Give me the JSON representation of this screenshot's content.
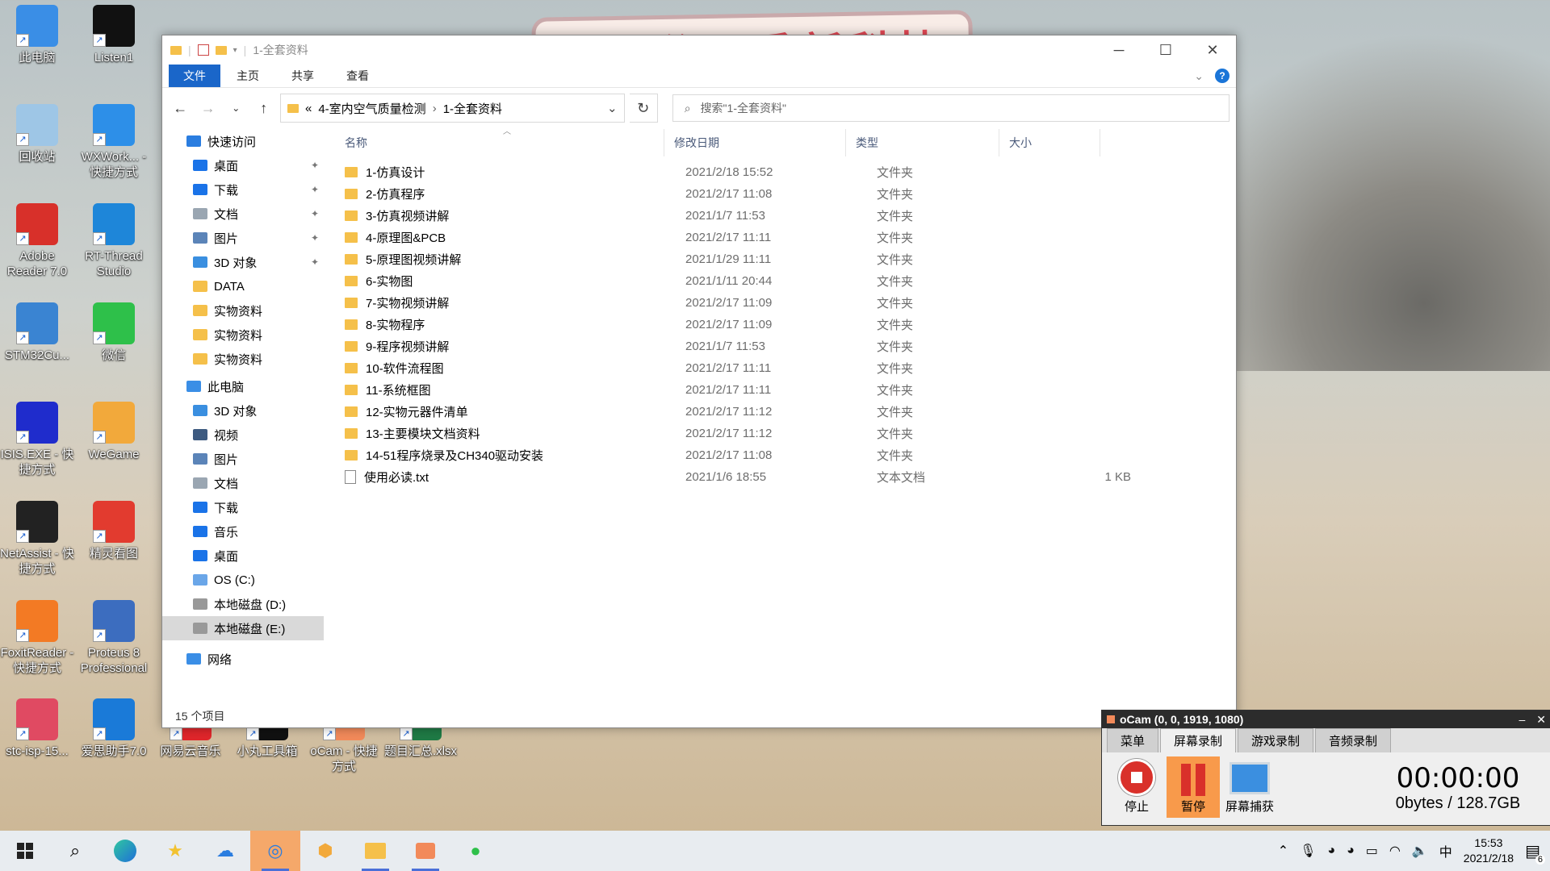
{
  "desktop_icons": [
    {
      "label": "此电脑",
      "color": "#3a8ee6"
    },
    {
      "label": "Listen1",
      "color": "#111111"
    },
    {
      "label": "回收站",
      "color": "#9ec6e6"
    },
    {
      "label": "WXWork... - 快捷方式",
      "color": "#2d8fe8"
    },
    {
      "label": "Adobe Reader 7.0",
      "color": "#d8302a"
    },
    {
      "label": "RT-Thread Studio",
      "color": "#1e86d9"
    },
    {
      "label": "STM32Cu...",
      "color": "#3a84d2"
    },
    {
      "label": "微信",
      "color": "#2ec04a"
    },
    {
      "label": "ISIS.EXE - 快捷方式",
      "color": "#1f2ccc"
    },
    {
      "label": "WeGame",
      "color": "#f2a93b"
    },
    {
      "label": "NetAssist - 快捷方式",
      "color": "#222222"
    },
    {
      "label": "精灵看图",
      "color": "#e23b2f"
    },
    {
      "label": "FoxitReader - 快捷方式",
      "color": "#f37a24"
    },
    {
      "label": "Proteus 8 Professional",
      "color": "#3c6dbf"
    },
    {
      "label": "stc-isp-15...",
      "color": "#e04a62"
    },
    {
      "label": "爱思助手7.0",
      "color": "#1a7ad8"
    },
    {
      "label": "网易云音乐",
      "color": "#e0262b"
    },
    {
      "label": "小丸工具箱",
      "color": "#111111"
    },
    {
      "label": "oCam - 快捷方式",
      "color": "#f28a5a"
    },
    {
      "label": "题目汇总.xlsx",
      "color": "#1f7a45"
    }
  ],
  "banner_text": "马爸爸：秀新科技",
  "explorer": {
    "title": "1-全套资料",
    "ribbon_tabs": [
      "文件",
      "主页",
      "共享",
      "查看"
    ],
    "address": {
      "prefix": "«",
      "crumbs": [
        "4-室内空气质量检测",
        "1-全套资料"
      ]
    },
    "search_placeholder": "搜索\"1-全套资料\"",
    "nav": {
      "quick_access": "快速访问",
      "quick_items": [
        {
          "label": "桌面",
          "icon": "desktop-icon",
          "color": "#1a73e8",
          "pinned": true
        },
        {
          "label": "下载",
          "icon": "download-icon",
          "color": "#1a73e8",
          "pinned": true
        },
        {
          "label": "文档",
          "icon": "document-icon",
          "color": "#9aa6b2",
          "pinned": true
        },
        {
          "label": "图片",
          "icon": "picture-icon",
          "color": "#5b84b8",
          "pinned": true
        },
        {
          "label": "3D 对象",
          "icon": "cube-icon",
          "color": "#3a8fe0",
          "pinned": true
        },
        {
          "label": "DATA",
          "icon": "folder-icon",
          "color": "#f5c04a",
          "pinned": false
        },
        {
          "label": "实物资料",
          "icon": "folder-icon",
          "color": "#f5c04a",
          "pinned": false
        },
        {
          "label": "实物资料",
          "icon": "folder-icon",
          "color": "#f5c04a",
          "pinned": false
        },
        {
          "label": "实物资料",
          "icon": "folder-icon",
          "color": "#f5c04a",
          "pinned": false
        }
      ],
      "this_pc": "此电脑",
      "pc_items": [
        {
          "label": "3D 对象",
          "icon": "cube-icon",
          "color": "#3a8fe0"
        },
        {
          "label": "视频",
          "icon": "video-icon",
          "color": "#3d5a80"
        },
        {
          "label": "图片",
          "icon": "picture-icon",
          "color": "#5b84b8"
        },
        {
          "label": "文档",
          "icon": "document-icon",
          "color": "#9aa6b2"
        },
        {
          "label": "下载",
          "icon": "download-icon",
          "color": "#1a73e8"
        },
        {
          "label": "音乐",
          "icon": "music-icon",
          "color": "#1a73e8"
        },
        {
          "label": "桌面",
          "icon": "desktop-icon",
          "color": "#1a73e8"
        },
        {
          "label": "OS (C:)",
          "icon": "windows-drive-icon",
          "color": "#6aa6e8"
        },
        {
          "label": "本地磁盘 (D:)",
          "icon": "drive-icon",
          "color": "#999999"
        },
        {
          "label": "本地磁盘 (E:)",
          "icon": "drive-icon",
          "color": "#999999"
        }
      ],
      "network": "网络"
    },
    "columns": [
      "名称",
      "修改日期",
      "类型",
      "大小"
    ],
    "files": [
      {
        "name": "1-仿真设计",
        "date": "2021/2/18 15:52",
        "type": "文件夹",
        "size": ""
      },
      {
        "name": "2-仿真程序",
        "date": "2021/2/17 11:08",
        "type": "文件夹",
        "size": ""
      },
      {
        "name": "3-仿真视频讲解",
        "date": "2021/1/7 11:53",
        "type": "文件夹",
        "size": ""
      },
      {
        "name": "4-原理图&PCB",
        "date": "2021/2/17 11:11",
        "type": "文件夹",
        "size": ""
      },
      {
        "name": "5-原理图视频讲解",
        "date": "2021/1/29 11:11",
        "type": "文件夹",
        "size": ""
      },
      {
        "name": "6-实物图",
        "date": "2021/1/11 20:44",
        "type": "文件夹",
        "size": ""
      },
      {
        "name": "7-实物视频讲解",
        "date": "2021/2/17 11:09",
        "type": "文件夹",
        "size": ""
      },
      {
        "name": "8-实物程序",
        "date": "2021/2/17 11:09",
        "type": "文件夹",
        "size": ""
      },
      {
        "name": "9-程序视频讲解",
        "date": "2021/1/7 11:53",
        "type": "文件夹",
        "size": ""
      },
      {
        "name": "10-软件流程图",
        "date": "2021/2/17 11:11",
        "type": "文件夹",
        "size": ""
      },
      {
        "name": "11-系统框图",
        "date": "2021/2/17 11:11",
        "type": "文件夹",
        "size": ""
      },
      {
        "name": "12-实物元器件清单",
        "date": "2021/2/17 11:12",
        "type": "文件夹",
        "size": ""
      },
      {
        "name": "13-主要模块文档资料",
        "date": "2021/2/17 11:12",
        "type": "文件夹",
        "size": ""
      },
      {
        "name": "14-51程序烧录及CH340驱动安装",
        "date": "2021/2/17 11:08",
        "type": "文件夹",
        "size": ""
      },
      {
        "name": "使用必读.txt",
        "date": "2021/1/6 18:55",
        "type": "文本文档",
        "size": "1 KB"
      }
    ],
    "status": "15 个项目"
  },
  "ocam": {
    "title": "oCam (0, 0, 1919, 1080)",
    "tabs": [
      "菜单",
      "屏幕录制",
      "游戏录制",
      "音频录制"
    ],
    "active_tab": 1,
    "buttons": {
      "stop": "停止",
      "pause": "暂停",
      "capture": "屏幕捕获"
    },
    "timer": "00:00:00",
    "storage": "0bytes / 128.7GB"
  },
  "taskbar": {
    "apps": [
      {
        "icon": "windows-start-icon"
      },
      {
        "icon": "search-icon"
      },
      {
        "icon": "edge-icon"
      },
      {
        "icon": "star-app-icon"
      },
      {
        "icon": "baidu-netdisk-icon"
      },
      {
        "icon": "wxwork-icon"
      },
      {
        "icon": "hexagon-app-icon"
      },
      {
        "icon": "file-explorer-icon"
      },
      {
        "icon": "ocam-icon"
      },
      {
        "icon": "wechat-icon"
      }
    ],
    "ime": "中",
    "time": "15:53",
    "date": "2021/2/18",
    "notifications": "6"
  }
}
